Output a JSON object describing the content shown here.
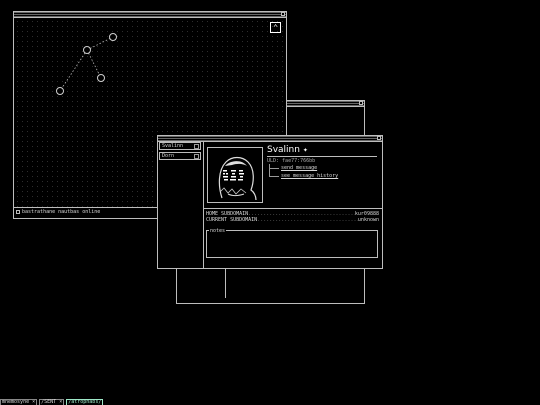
{
  "map_window": {
    "status_text": "bastrathane nautbas online"
  },
  "profile_window": {
    "tabs": [
      "Svalinn",
      "Dorn"
    ],
    "name": "Svalinn",
    "status_glyph": "✦",
    "uid": "ULD: fae77:766bb",
    "actions": [
      "send message",
      "see message history"
    ],
    "home_label": "HOME SUBDOMAIN",
    "home_value": "kur09888",
    "current_label": "CURRENT SUBDOMAIN",
    "current_value": "unknown",
    "notes_label": "notes"
  },
  "taskbar": {
    "items": [
      "mnemosyne",
      "SENT",
      "atrophabs"
    ]
  }
}
